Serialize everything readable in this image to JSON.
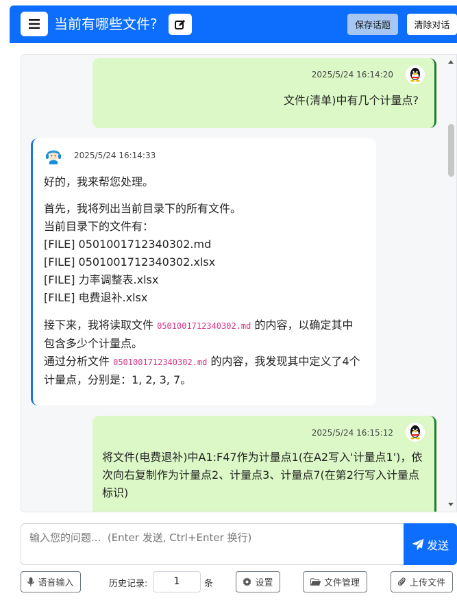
{
  "header": {
    "title": "当前有哪些文件?",
    "save_label": "保存话题",
    "clear_label": "清除对话"
  },
  "messages": [
    {
      "role": "user",
      "timestamp": "2025/5/24 16:14:20",
      "lines": [
        "文件(清单)中有几个计量点?"
      ]
    },
    {
      "role": "assistant",
      "timestamp": "2025/5/24 16:14:33",
      "p1": "好的，我来帮您处理。",
      "p2": [
        "首先，我将列出当前目录下的所有文件。",
        "当前目录下的文件有：",
        "[FILE] 0501001712340302.md",
        "[FILE] 0501001712340302.xlsx",
        "[FILE] 力率调整表.xlsx",
        "[FILE] 电费退补.xlsx"
      ],
      "p3a_pre": "接下来，我将读取文件 ",
      "p3a_code": "0501001712340302.md",
      "p3a_post": " 的内容，以确定其中",
      "p3b": "包含多少个计量点。",
      "p3c_pre": "通过分析文件 ",
      "p3c_code": "0501001712340302.md",
      "p3c_post": " 的内容，我发现其中定义了4个",
      "p3d": "计量点，分别是：1, 2, 3, 7。"
    },
    {
      "role": "user",
      "timestamp": "2025/5/24 16:15:12",
      "lines": [
        "将文件(电费退补)中A1:F47作为计量点1(在A2写入'计量点1')，依",
        "次向右复制作为计量点2、计量点3、计量点7(在第2行写入计量点",
        "标识)"
      ]
    }
  ],
  "input": {
    "placeholder": "输入您的问题...  (Enter 发送, Ctrl+Enter 换行)",
    "send_label": "发送"
  },
  "toolbar": {
    "voice_label": "语音输入",
    "history_label": "历史记录:",
    "history_value": "1",
    "history_unit": "条",
    "settings_label": "设置",
    "files_label": "文件管理",
    "upload_label": "上传文件"
  },
  "colors": {
    "primary": "#0d6efd",
    "user_bubble": "#dcf8c6",
    "user_border": "#1a7f2a",
    "bot_border": "#1a73e8",
    "code": "#d63384"
  },
  "icons": [
    "menu-icon",
    "edit-icon",
    "qq-penguin-icon",
    "assistant-avatar-icon",
    "send-icon",
    "microphone-icon",
    "gear-icon",
    "folder-icon",
    "paperclip-icon"
  ]
}
